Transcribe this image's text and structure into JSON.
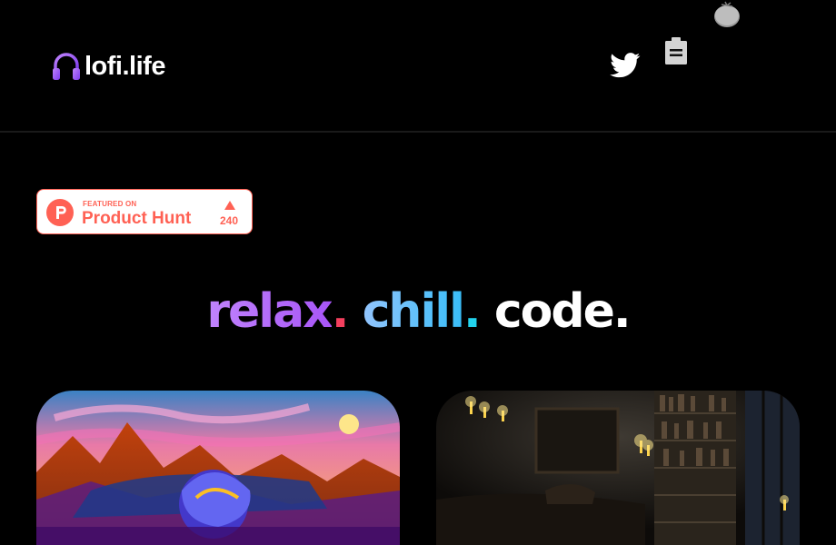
{
  "header": {
    "logo_text": "lofi.life",
    "icons": {
      "logo": "headphones-icon",
      "twitter": "twitter-icon",
      "notes": "notes-icon",
      "timer": "tomato-icon"
    }
  },
  "product_hunt": {
    "featured_label": "FEATURED ON",
    "name": "Product Hunt",
    "count": "240",
    "color": "#ff6154"
  },
  "headline": {
    "word1": "relax",
    "word2": "chill",
    "word3": "code",
    "dot": "."
  },
  "cards": [
    {
      "name": "retro-sunset-scene"
    },
    {
      "name": "dark-library-scene"
    }
  ],
  "colors": {
    "background": "#000000",
    "relax_gradient": [
      "#c084fc",
      "#a855f7"
    ],
    "chill_gradient": [
      "#93c5fd",
      "#38bdf8"
    ],
    "relax_dot": "#f43f5e",
    "chill_dot": "#22d3ee"
  }
}
